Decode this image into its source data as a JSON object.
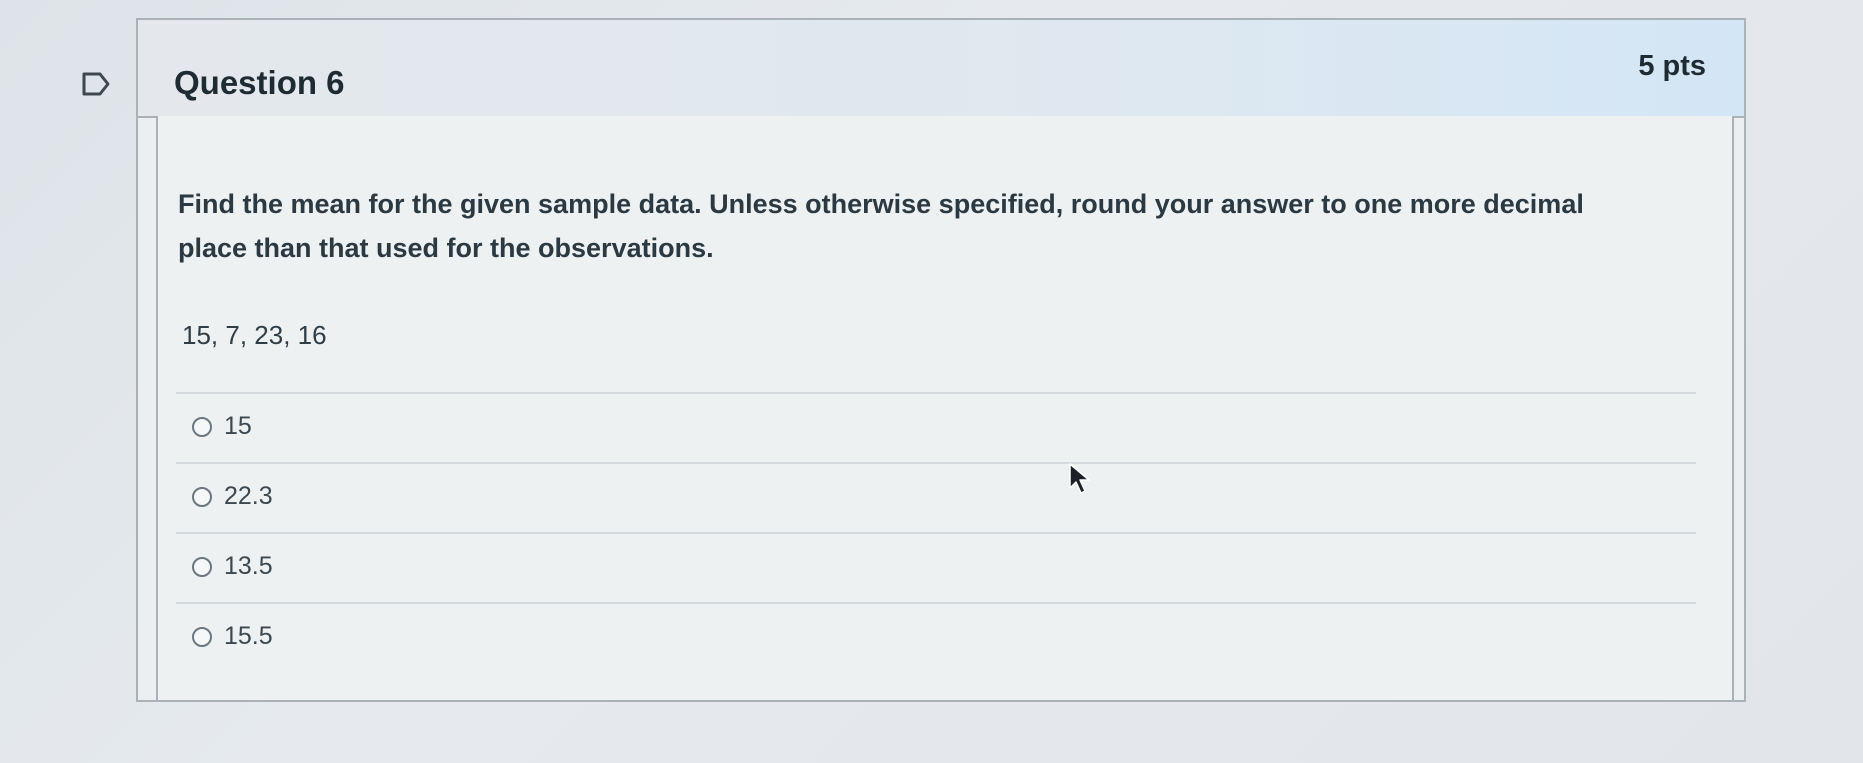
{
  "question": {
    "title": "Question 6",
    "points": "5 pts",
    "prompt": "Find the mean for the given sample data. Unless otherwise specified, round your answer to one more decimal place than that used for the observations.",
    "sample_data": "15, 7, 23, 16",
    "answers": [
      {
        "label": "15"
      },
      {
        "label": "22.3"
      },
      {
        "label": "13.5"
      },
      {
        "label": "15.5"
      }
    ]
  },
  "icons": {
    "flag": "flag-icon",
    "radio": "radio-button-icon",
    "cursor": "mouse-pointer-icon"
  }
}
